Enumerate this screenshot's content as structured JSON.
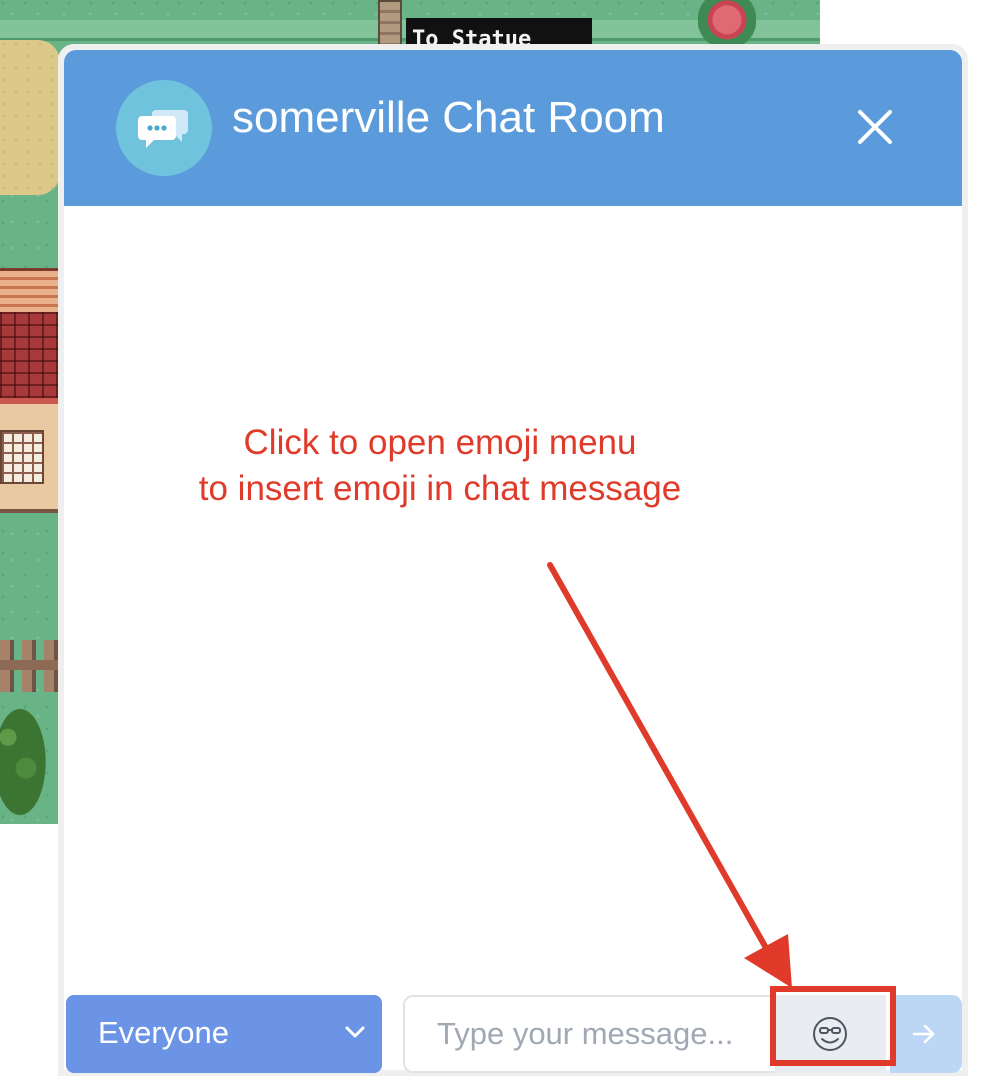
{
  "game": {
    "sign_text": "To Statue"
  },
  "chat": {
    "title": "somerville Chat Room",
    "avatar_icon": "chat-bubbles-icon",
    "close_icon": "close-icon",
    "header_color": "#5b9bdc"
  },
  "annotation": {
    "line1": "Click to open emoji menu",
    "line2": "to insert emoji in chat message",
    "color": "#e03a2b"
  },
  "composer": {
    "recipient_selected": "Everyone",
    "message_value": "",
    "message_placeholder": "Type your message...",
    "emoji_icon": "smiley-sunglasses-icon",
    "send_icon": "arrow-right-icon"
  }
}
